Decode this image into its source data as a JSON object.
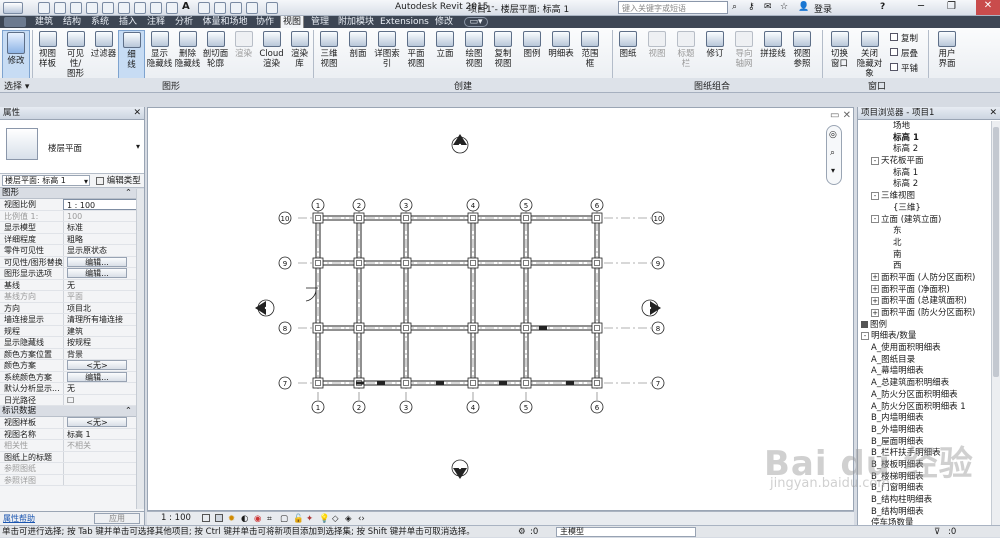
{
  "app": {
    "title": "Autodesk Revit 2015 -",
    "document": "项目1 - 楼层平面: 标高 1",
    "search_placeholder": "键入关键字或短语",
    "login_label": "登录",
    "help_label": "?"
  },
  "tabs": [
    "建筑",
    "结构",
    "系统",
    "插入",
    "注释",
    "分析",
    "体量和场地",
    "协作",
    "视图",
    "管理",
    "附加模块",
    "Extensions",
    "修改"
  ],
  "active_tab": "视图",
  "ribbon": {
    "modify": "修改",
    "select_label": "选择 ▾",
    "graphics_buttons": [
      {
        "label": "视图\n样板",
        "dim": false
      },
      {
        "label": "可见性/\n图形",
        "dim": false
      },
      {
        "label": "过滤器",
        "dim": false
      },
      {
        "label": "细\n线",
        "dim": false,
        "selected": true
      },
      {
        "label": "显示\n隐藏线",
        "dim": false
      },
      {
        "label": "删除\n隐藏线",
        "dim": false
      },
      {
        "label": "剖切面\n轮廓",
        "dim": false
      },
      {
        "label": "渲染",
        "dim": true
      },
      {
        "label": "Cloud\n渲染",
        "dim": false
      },
      {
        "label": "渲染\n库",
        "dim": false
      }
    ],
    "create_buttons": [
      {
        "label": "三维\n视图",
        "dim": false
      },
      {
        "label": "剖面",
        "dim": false
      },
      {
        "label": "详图索引",
        "dim": false
      },
      {
        "label": "平面\n视图",
        "dim": false
      },
      {
        "label": "立面",
        "dim": false
      },
      {
        "label": "绘图\n视图",
        "dim": false
      },
      {
        "label": "复制\n视图",
        "dim": false
      },
      {
        "label": "图例",
        "dim": false
      },
      {
        "label": "明细表",
        "dim": false
      },
      {
        "label": "范围\n框",
        "dim": false
      }
    ],
    "sheet_buttons": [
      {
        "label": "图纸",
        "dim": false
      },
      {
        "label": "视图",
        "dim": true
      },
      {
        "label": "标题\n栏",
        "dim": true
      },
      {
        "label": "修订",
        "dim": false
      },
      {
        "label": "导向\n轴网",
        "dim": true
      },
      {
        "label": "拼接线",
        "dim": false
      },
      {
        "label": "视图\n参照",
        "dim": false
      }
    ],
    "window_buttons": [
      {
        "label": "切换\n窗口",
        "dim": false
      },
      {
        "label": "关闭\n隐藏对象",
        "dim": false
      }
    ],
    "window_small": [
      "复制",
      "层叠",
      "平铺"
    ],
    "ui_button": "用户\n界面",
    "groups": {
      "graphics": "图形",
      "create": "创建",
      "sheet": "图纸组合",
      "window": "窗口"
    }
  },
  "properties": {
    "header": "属性",
    "type_name": "楼层平面",
    "instance_selector": "楼层平面: 标高 1",
    "edit_type": "编辑类型",
    "sections": [
      {
        "name": "图形",
        "rows": [
          {
            "k": "视图比例",
            "v": "1 : 100",
            "input": true
          },
          {
            "k": "比例值 1:",
            "v": "100",
            "dis": true
          },
          {
            "k": "显示模型",
            "v": "标准"
          },
          {
            "k": "详细程度",
            "v": "粗略"
          },
          {
            "k": "零件可见性",
            "v": "显示原状态"
          },
          {
            "k": "可见性/图形替换",
            "v": "编辑...",
            "btn": true
          },
          {
            "k": "图形显示选项",
            "v": "编辑...",
            "btn": true
          },
          {
            "k": "基线",
            "v": "无"
          },
          {
            "k": "基线方向",
            "v": "平面",
            "dis": true
          },
          {
            "k": "方向",
            "v": "项目北"
          },
          {
            "k": "墙连接显示",
            "v": "清理所有墙连接"
          },
          {
            "k": "规程",
            "v": "建筑"
          },
          {
            "k": "显示隐藏线",
            "v": "按规程"
          },
          {
            "k": "颜色方案位置",
            "v": "背景"
          },
          {
            "k": "颜色方案",
            "v": "<无>",
            "btn": true
          },
          {
            "k": "系统颜色方案",
            "v": "编辑...",
            "btn": true
          },
          {
            "k": "默认分析显示...",
            "v": "无"
          },
          {
            "k": "日光路径",
            "v": "☐"
          }
        ]
      },
      {
        "name": "标识数据",
        "rows": [
          {
            "k": "视图样板",
            "v": "<无>",
            "btn": true
          },
          {
            "k": "视图名称",
            "v": "标高 1"
          },
          {
            "k": "相关性",
            "v": "不相关",
            "dis": true
          },
          {
            "k": "图纸上的标题",
            "v": ""
          },
          {
            "k": "参照图纸",
            "v": "",
            "dis": true
          },
          {
            "k": "参照详图",
            "v": "",
            "dis": true
          }
        ]
      }
    ],
    "help_link": "属性帮助",
    "apply": "应用"
  },
  "view_bar": {
    "scale": "1 : 100"
  },
  "drawing": {
    "top_grids": [
      "1",
      "2",
      "3",
      "4",
      "5",
      "6"
    ],
    "side_grids": [
      "10",
      "9",
      "8",
      "7"
    ]
  },
  "browser": {
    "header": "项目浏览器 - 项目1",
    "items": [
      {
        "t": "场地",
        "lvl": 3
      },
      {
        "t": "标高 1",
        "lvl": 3,
        "bold": true
      },
      {
        "t": "标高 2",
        "lvl": 3
      },
      {
        "t": "天花板平面",
        "lvl": 2,
        "tog": "-"
      },
      {
        "t": "标高 1",
        "lvl": 3
      },
      {
        "t": "标高 2",
        "lvl": 3
      },
      {
        "t": "三维视图",
        "lvl": 2,
        "tog": "-"
      },
      {
        "t": "{三维}",
        "lvl": 3
      },
      {
        "t": "立面 (建筑立面)",
        "lvl": 2,
        "tog": "-"
      },
      {
        "t": "东",
        "lvl": 3
      },
      {
        "t": "北",
        "lvl": 3
      },
      {
        "t": "南",
        "lvl": 3
      },
      {
        "t": "西",
        "lvl": 3
      },
      {
        "t": "面积平面 (人防分区面积)",
        "lvl": 2,
        "tog": "+"
      },
      {
        "t": "面积平面 (净面积)",
        "lvl": 2,
        "tog": "+"
      },
      {
        "t": "面积平面 (总建筑面积)",
        "lvl": 2,
        "tog": "+"
      },
      {
        "t": "面积平面 (防火分区面积)",
        "lvl": 2,
        "tog": "+"
      },
      {
        "t": "图例",
        "lvl": 1,
        "tog": "■"
      },
      {
        "t": "明细表/数量",
        "lvl": 1,
        "tog": "-"
      },
      {
        "t": "A_使用面积明细表",
        "lvl": 2
      },
      {
        "t": "A_图纸目录",
        "lvl": 2
      },
      {
        "t": "A_幕墙明细表",
        "lvl": 2
      },
      {
        "t": "A_总建筑面积明细表",
        "lvl": 2
      },
      {
        "t": "A_防火分区面积明细表",
        "lvl": 2
      },
      {
        "t": "A_防火分区面积明细表 1",
        "lvl": 2
      },
      {
        "t": "B_内墙明细表",
        "lvl": 2
      },
      {
        "t": "B_外墙明细表",
        "lvl": 2
      },
      {
        "t": "B_屋面明细表",
        "lvl": 2
      },
      {
        "t": "B_栏杆扶手明细表",
        "lvl": 2
      },
      {
        "t": "B_楼板明细表",
        "lvl": 2
      },
      {
        "t": "B_楼梯明细表",
        "lvl": 2
      },
      {
        "t": "B_门窗明细表",
        "lvl": 2
      },
      {
        "t": "B_结构柱明细表",
        "lvl": 2
      },
      {
        "t": "B_结构明细表",
        "lvl": 2
      },
      {
        "t": "停车场数量",
        "lvl": 2
      }
    ]
  },
  "status": {
    "text": "单击可进行选择; 按 Tab 键并单击可选择其他项目; 按 Ctrl 键并单击可将新项目添加到选择集; 按 Shift 键并单击可取消选择。",
    "zero": ":0",
    "model": "主模型"
  },
  "watermark": {
    "text": "Bai du 经验",
    "url": "jingyan.baidu.com"
  }
}
